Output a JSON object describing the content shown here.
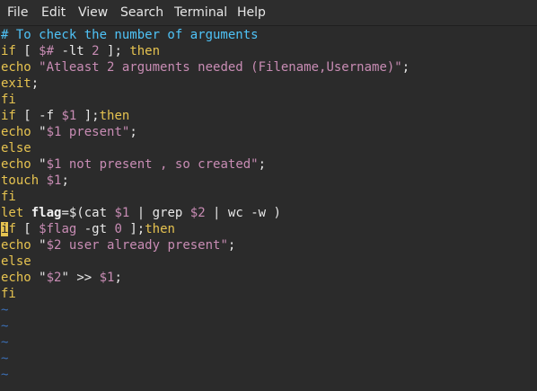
{
  "menu": {
    "items": [
      "File",
      "Edit",
      "View",
      "Search",
      "Terminal",
      "Help"
    ]
  },
  "colors": {
    "background": "#2b2b2b",
    "default": "#e8e8e8",
    "comment": "#4fc3f7",
    "keyword": "#e6c350",
    "builtin": "#e6c350",
    "string": "#c88cb4",
    "variable": "#c88cb4",
    "number": "#c88cb4",
    "bold": "#f0f0f0",
    "tilde": "#3c6fb5",
    "cursor": "#e6c350"
  },
  "editor": {
    "lines": [
      [
        {
          "t": "# To check the number of arguments",
          "c": "comment"
        }
      ],
      [
        {
          "t": "if",
          "c": "keyword"
        },
        {
          "t": " [ ",
          "c": "default"
        },
        {
          "t": "$#",
          "c": "variable"
        },
        {
          "t": " -lt ",
          "c": "default"
        },
        {
          "t": "2",
          "c": "number"
        },
        {
          "t": " ]; ",
          "c": "default"
        },
        {
          "t": "then",
          "c": "keyword"
        }
      ],
      [
        {
          "t": "echo",
          "c": "builtin"
        },
        {
          "t": " ",
          "c": "default"
        },
        {
          "t": "\"Atleast 2 arguments needed (Filename,Username)\"",
          "c": "string"
        },
        {
          "t": ";",
          "c": "default"
        }
      ],
      [
        {
          "t": "exit",
          "c": "builtin"
        },
        {
          "t": ";",
          "c": "default"
        }
      ],
      [
        {
          "t": "fi",
          "c": "keyword"
        }
      ],
      [
        {
          "t": "if",
          "c": "keyword"
        },
        {
          "t": " [ -f ",
          "c": "default"
        },
        {
          "t": "$1",
          "c": "variable"
        },
        {
          "t": " ];",
          "c": "default"
        },
        {
          "t": "then",
          "c": "keyword"
        }
      ],
      [
        {
          "t": "echo",
          "c": "builtin"
        },
        {
          "t": " ",
          "c": "default"
        },
        {
          "t": "\"",
          "c": "default"
        },
        {
          "t": "$1",
          "c": "variable"
        },
        {
          "t": " present\"",
          "c": "string"
        },
        {
          "t": ";",
          "c": "default"
        }
      ],
      [
        {
          "t": "else",
          "c": "keyword"
        }
      ],
      [
        {
          "t": "echo",
          "c": "builtin"
        },
        {
          "t": " ",
          "c": "default"
        },
        {
          "t": "\"",
          "c": "default"
        },
        {
          "t": "$1",
          "c": "variable"
        },
        {
          "t": " not present , so created\"",
          "c": "string"
        },
        {
          "t": ";",
          "c": "default"
        }
      ],
      [
        {
          "t": "touch",
          "c": "builtin"
        },
        {
          "t": " ",
          "c": "default"
        },
        {
          "t": "$1",
          "c": "variable"
        },
        {
          "t": ";",
          "c": "default"
        }
      ],
      [
        {
          "t": "fi",
          "c": "keyword"
        }
      ],
      [
        {
          "t": "let",
          "c": "builtin"
        },
        {
          "t": " ",
          "c": "default"
        },
        {
          "t": "flag",
          "c": "bold"
        },
        {
          "t": "=$(cat ",
          "c": "default"
        },
        {
          "t": "$1",
          "c": "variable"
        },
        {
          "t": " | grep ",
          "c": "default"
        },
        {
          "t": "$2",
          "c": "variable"
        },
        {
          "t": " | wc -w )",
          "c": "default"
        }
      ],
      [
        {
          "t": "i",
          "c": "cursor"
        },
        {
          "t": "f",
          "c": "keyword"
        },
        {
          "t": " [ ",
          "c": "default"
        },
        {
          "t": "$flag",
          "c": "variable"
        },
        {
          "t": " -gt ",
          "c": "default"
        },
        {
          "t": "0",
          "c": "number"
        },
        {
          "t": " ];",
          "c": "default"
        },
        {
          "t": "then",
          "c": "keyword"
        }
      ],
      [
        {
          "t": "echo",
          "c": "builtin"
        },
        {
          "t": " ",
          "c": "default"
        },
        {
          "t": "\"",
          "c": "default"
        },
        {
          "t": "$2",
          "c": "variable"
        },
        {
          "t": " user already present\"",
          "c": "string"
        },
        {
          "t": ";",
          "c": "default"
        }
      ],
      [
        {
          "t": "else",
          "c": "keyword"
        }
      ],
      [
        {
          "t": "echo",
          "c": "builtin"
        },
        {
          "t": " ",
          "c": "default"
        },
        {
          "t": "\"",
          "c": "default"
        },
        {
          "t": "$2",
          "c": "variable"
        },
        {
          "t": "\"",
          "c": "default"
        },
        {
          "t": " >> ",
          "c": "default"
        },
        {
          "t": "$1",
          "c": "variable"
        },
        {
          "t": ";",
          "c": "default"
        }
      ],
      [
        {
          "t": "fi",
          "c": "keyword"
        }
      ],
      [
        {
          "t": "~",
          "c": "tilde"
        }
      ],
      [
        {
          "t": "~",
          "c": "tilde"
        }
      ],
      [
        {
          "t": "~",
          "c": "tilde"
        }
      ],
      [
        {
          "t": "~",
          "c": "tilde"
        }
      ],
      [
        {
          "t": "~",
          "c": "tilde"
        }
      ]
    ]
  }
}
